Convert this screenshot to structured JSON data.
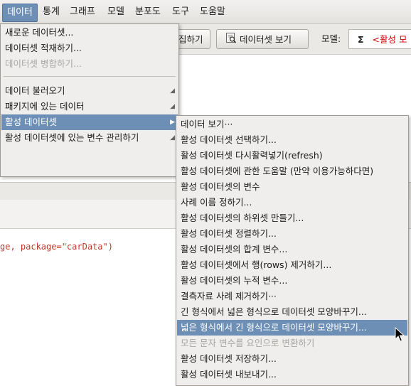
{
  "menubar": {
    "items": [
      "데이터",
      "통계",
      "그래프",
      "모델",
      "분포도",
      "도구",
      "도움말"
    ]
  },
  "toolbar": {
    "edit_button_partial": "집하기",
    "view_dataset_button": "데이터셋 보기",
    "model_label": "모델:",
    "model_sigma": "Σ",
    "model_value_partial": "<활성 모"
  },
  "console": {
    "code_fragment": "ge, package=\"carData\")"
  },
  "data_menu": {
    "items": [
      {
        "label": "새로운 데이터셋...",
        "disabled": false
      },
      {
        "label": "데이터셋 적재하기...",
        "disabled": false
      },
      {
        "label": "데이터셋 병합하기...",
        "disabled": true
      },
      {
        "label": "데이터 불러오기",
        "disabled": false,
        "submenu": true
      },
      {
        "label": "패키지에 있는 데이터",
        "disabled": false,
        "submenu": true
      },
      {
        "label": "활성 데이터셋",
        "disabled": false,
        "submenu": true,
        "highlight": true
      },
      {
        "label": "활성 데이터셋에 있는 변수 관리하기",
        "disabled": false,
        "submenu": true
      }
    ]
  },
  "active_dataset_menu": {
    "items": [
      {
        "label": "데이터 보기···",
        "disabled": false
      },
      {
        "label": "활성 데이터셋 선택하기...",
        "disabled": false
      },
      {
        "label": "활성 데이터셋 다시활력넣기(refresh)",
        "disabled": false
      },
      {
        "label": "활성 데이터셋에 관한 도움말 (만약 이용가능하다면)",
        "disabled": false
      },
      {
        "label": "활성 데이터셋의 변수",
        "disabled": false
      },
      {
        "label": "사례 이름 정하기...",
        "disabled": false
      },
      {
        "label": "활성 데이터셋의 하위셋 만들기...",
        "disabled": false
      },
      {
        "label": "활성 데이터셋 정렬하기...",
        "disabled": false
      },
      {
        "label": "활성 데이터셋의 합계 변수...",
        "disabled": false
      },
      {
        "label": "활성 데이터셋에서 행(rows) 제거하기...",
        "disabled": false
      },
      {
        "label": "활성 데이터셋의 누적 변수...",
        "disabled": false
      },
      {
        "label": "결측자료 사례 제거하기···",
        "disabled": false
      },
      {
        "label": "긴 형식에서 넓은 형식으로 데이터셋 모양바꾸기...",
        "disabled": false
      },
      {
        "label": "넓은 형식에서 긴 형식으로 데이터셋 모양바꾸기...",
        "disabled": false,
        "highlight": true
      },
      {
        "label": "모든 문자 변수를 요인으로 변환하기",
        "disabled": true
      },
      {
        "label": "활성 데이터셋 저장하기...",
        "disabled": false
      },
      {
        "label": "활성 데이터셋 내보내기...",
        "disabled": false
      }
    ]
  },
  "colors": {
    "highlight": "#6e8fb5",
    "model_text": "#cc0000"
  }
}
